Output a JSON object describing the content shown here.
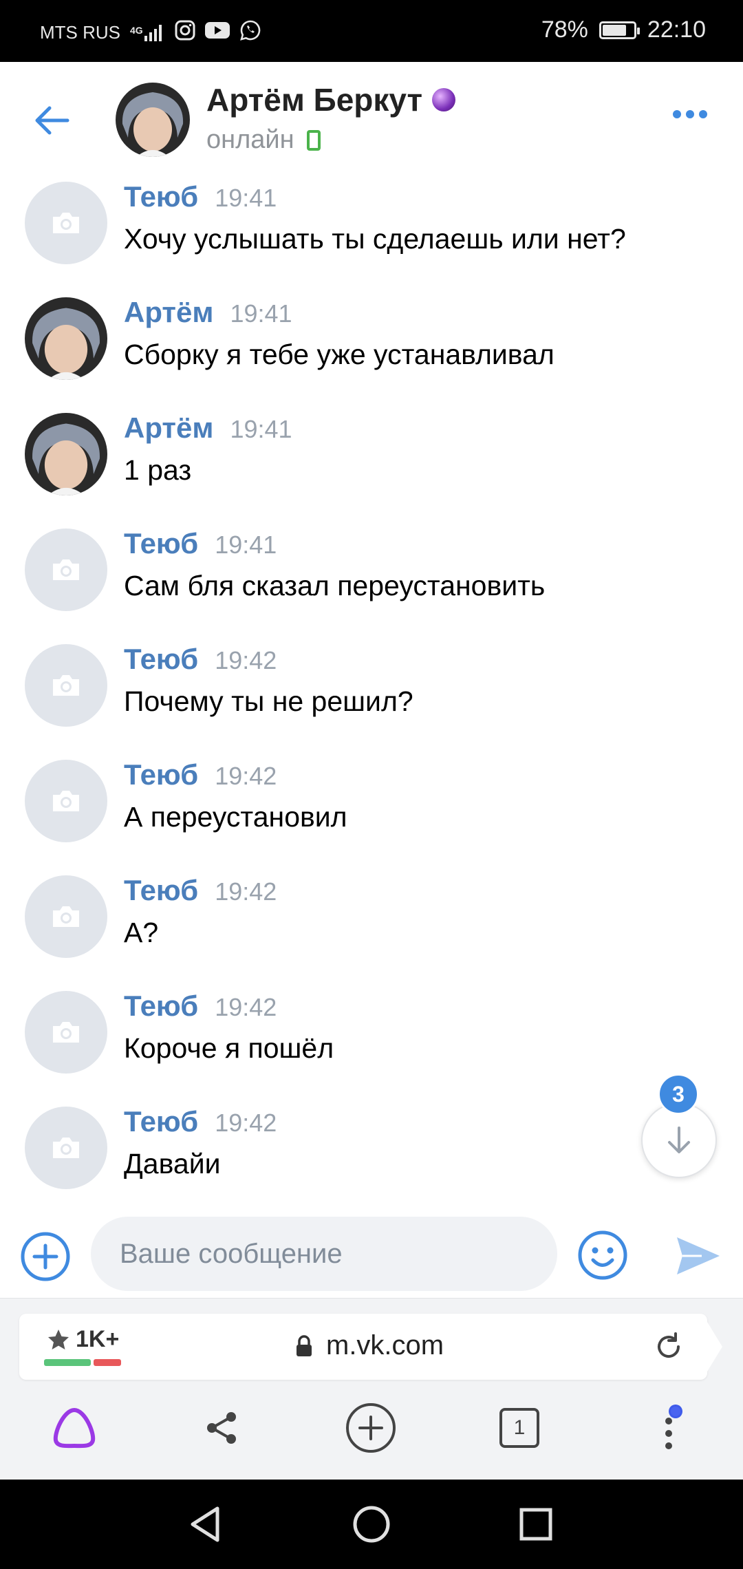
{
  "status_bar": {
    "carrier": "MTS RUS",
    "network": "4G",
    "battery": "78%",
    "battery_level": 0.78,
    "time": "22:10",
    "notification_icons": [
      "instagram-icon",
      "youtube-icon",
      "whatsapp-icon"
    ]
  },
  "header": {
    "name": "Артём Беркут",
    "status": "онлайн",
    "badge_icon": "crystal-ball-icon"
  },
  "messages": [
    {
      "author": "Теюб",
      "time": "19:41",
      "text": "Хочу услышать ты сделаешь или нет?",
      "avatar": "placeholder"
    },
    {
      "author": "Артём",
      "time": "19:41",
      "text": "Сборку я тебе уже устанавливал",
      "avatar": "photo"
    },
    {
      "author": "Артём",
      "time": "19:41",
      "text": "1 раз",
      "avatar": "photo"
    },
    {
      "author": "Теюб",
      "time": "19:41",
      "text": "Сам бля сказал переустановить",
      "avatar": "placeholder"
    },
    {
      "author": "Теюб",
      "time": "19:42",
      "text": "Почему ты не решил?",
      "avatar": "placeholder"
    },
    {
      "author": "Теюб",
      "time": "19:42",
      "text": "А переустановил",
      "avatar": "placeholder"
    },
    {
      "author": "Теюб",
      "time": "19:42",
      "text": "А?",
      "avatar": "placeholder"
    },
    {
      "author": "Теюб",
      "time": "19:42",
      "text": "Короче я пошёл",
      "avatar": "placeholder"
    },
    {
      "author": "Теюб",
      "time": "19:42",
      "text": "Давайи",
      "avatar": "placeholder"
    }
  ],
  "scroll_down": {
    "unread_count": "3"
  },
  "composer": {
    "placeholder": "Ваше сообщение"
  },
  "browser": {
    "rating": "1K+",
    "url": "m.vk.com",
    "tabs_count": "1"
  },
  "colors": {
    "accent": "#3f8ae0",
    "author_name": "#4a7ebb",
    "online": "#4bb34b",
    "alice_purple": "#9b39e5"
  }
}
